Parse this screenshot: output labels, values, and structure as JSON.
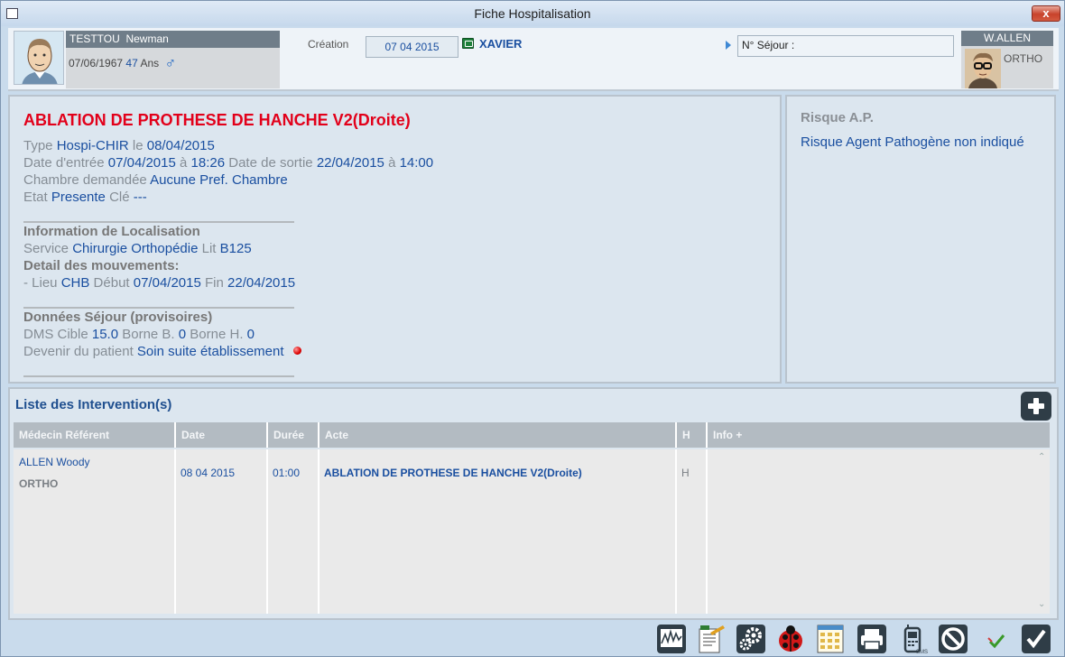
{
  "window": {
    "title": "Fiche Hospitalisation",
    "close_label": "x"
  },
  "patient": {
    "name": "TESTTOU  Newman",
    "dob": "07/06/1967",
    "age": "47",
    "age_unit": "Ans",
    "sex_symbol": "♂"
  },
  "creation": {
    "label": "Création",
    "date": "07 04 2015",
    "user": "XAVIER"
  },
  "sejour": {
    "label": "N° Séjour :",
    "value": ""
  },
  "doctor": {
    "name": "W.ALLEN",
    "specialty": "ORTHO"
  },
  "main": {
    "title": "ABLATION DE PROTHESE DE HANCHE V2(Droite)",
    "type_label": "Type",
    "type": "Hospi-CHIR",
    "le_label": "le",
    "type_date": "08/04/2015",
    "entry_label": "Date d'entrée",
    "entry_date": "07/04/2015",
    "a_label": "à",
    "entry_time": "18:26",
    "exit_label": "Date de sortie",
    "exit_date": "22/04/2015",
    "exit_time": "14:00",
    "room_label": "Chambre demandée",
    "room": "Aucune Pref. Chambre",
    "state_label": "Etat",
    "state": "Presente",
    "key_label": "Clé",
    "key": "---",
    "loc_title": "Information de Localisation",
    "service_label": "Service",
    "service": "Chirurgie Orthopédie",
    "lit_label": "Lit",
    "lit": "B125",
    "mvt_title": "Detail des mouvements:",
    "lieu_label": "- Lieu",
    "lieu": "CHB",
    "debut_label": "Début",
    "debut": "07/04/2015",
    "fin_label": "Fin",
    "fin": "22/04/2015",
    "sejour_title": "Données Séjour (provisoires)",
    "dms_label": "DMS Cible",
    "dms": "15.0",
    "borne_b_label": "Borne B.",
    "borne_b": "0",
    "borne_h_label": "Borne H.",
    "borne_h": "0",
    "devenir_label": "Devenir du patient",
    "devenir": "Soin suite établissement"
  },
  "risk": {
    "title": "Risque A.P.",
    "text": "Risque Agent Pathogène non indiqué"
  },
  "interventions": {
    "title": "Liste des Intervention(s)",
    "columns": [
      "Médecin Référent",
      "Date",
      "Durée",
      "Acte",
      "H",
      "Info +"
    ],
    "rows": [
      {
        "medecin": "ALLEN Woody",
        "specialite": "ORTHO",
        "date": "08 04 2015",
        "duree": "01:00",
        "acte": "ABLATION DE PROTHESE DE HANCHE V2(Droite)",
        "h": "H",
        "info": ""
      }
    ]
  },
  "toolbar": [
    "chart-icon",
    "document-edit-icon",
    "settings-icon",
    "ladybug-icon",
    "calendar-grid-icon",
    "printer-icon",
    "sms-phone-icon",
    "cancel-icon",
    "checkmark-small-icon",
    "validate-icon"
  ],
  "colors": {
    "title_red": "#e2001a",
    "value_blue": "#1a4fa0",
    "panel_bg": "#dce6ef"
  }
}
